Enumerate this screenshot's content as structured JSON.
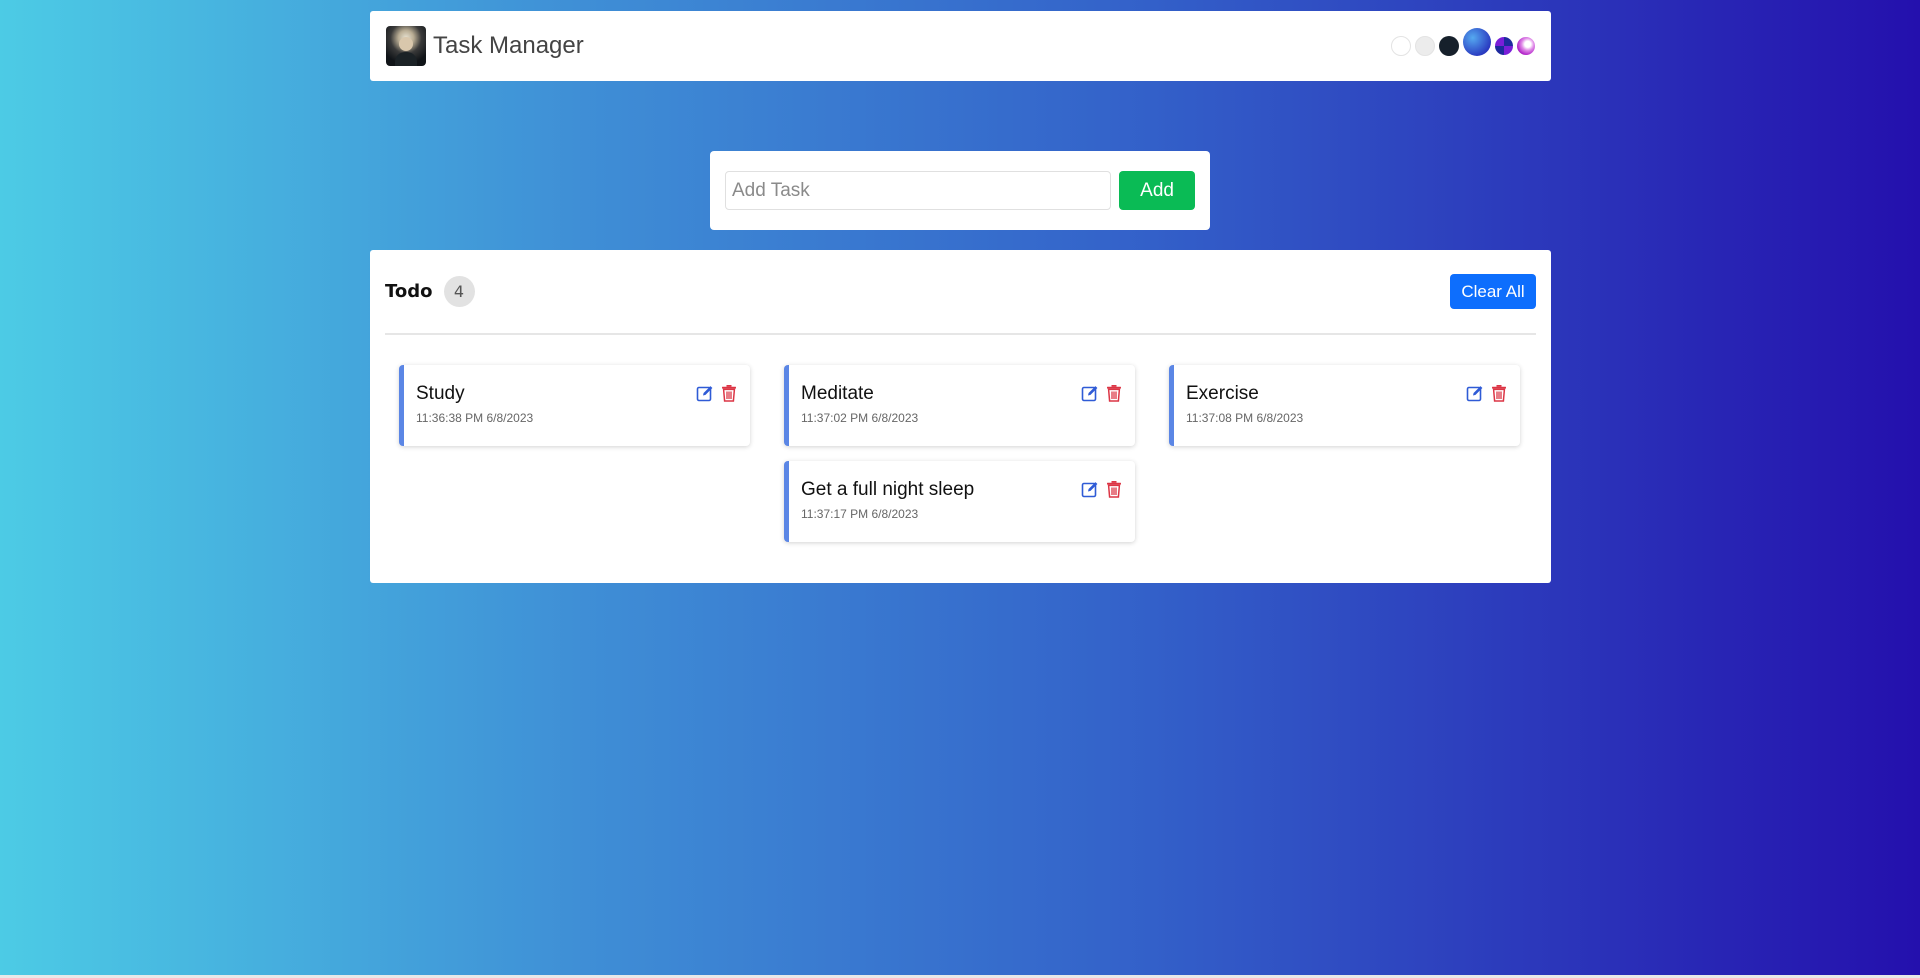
{
  "header": {
    "app_title": "Task Manager",
    "themes": [
      "light",
      "gray",
      "dark",
      "ocean",
      "purple",
      "pink"
    ]
  },
  "add_task": {
    "placeholder": "Add Task",
    "value": "",
    "button_label": "Add",
    "button_color": "#0abb55"
  },
  "todo": {
    "title": "Todo",
    "count": "4",
    "clear_label": "Clear All",
    "clear_color": "#0d6efd",
    "tasks": [
      {
        "name": "Study",
        "time": "11:36:38 PM 6/8/2023"
      },
      {
        "name": "Meditate",
        "time": "11:37:02 PM 6/8/2023"
      },
      {
        "name": "Exercise",
        "time": "11:37:08 PM 6/8/2023"
      },
      {
        "name": "Get a full night sleep",
        "time": "11:37:17 PM 6/8/2023"
      }
    ]
  },
  "colors": {
    "accent_border": "#5b86e5",
    "edit_icon": "#2f5bd6",
    "delete_icon": "#dc3545",
    "background_start": "#4ccbe5",
    "background_end": "#2410ad"
  }
}
